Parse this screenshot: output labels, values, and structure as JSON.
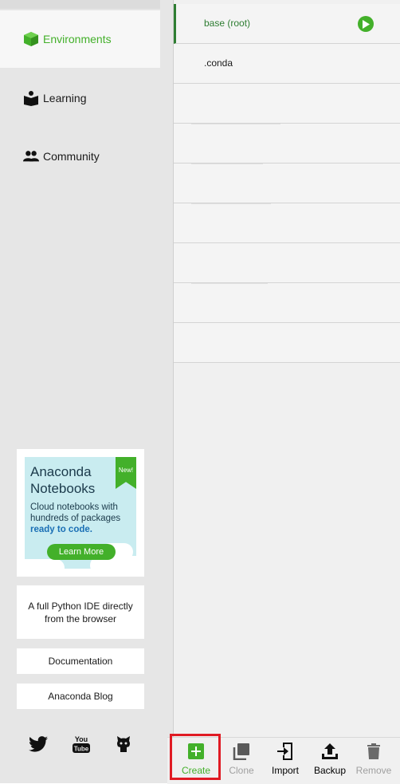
{
  "sidebar": {
    "nav": [
      {
        "label": "Environments",
        "icon": "cube-icon",
        "active": true
      },
      {
        "label": "Learning",
        "icon": "book-reader-icon",
        "active": false
      },
      {
        "label": "Community",
        "icon": "people-icon",
        "active": false
      }
    ],
    "promo": {
      "title_line1": "Anaconda",
      "title_line2": "Notebooks",
      "desc_line1": "Cloud notebooks with",
      "desc_line2": "hundreds of packages",
      "desc_highlight": "ready to code.",
      "badge": "New!",
      "button": "Learn More"
    },
    "ide_text": "A full Python IDE directly from the browser",
    "documentation": "Documentation",
    "blog": "Anaconda Blog",
    "social": [
      "twitter-icon",
      "youtube-icon",
      "github-icon"
    ],
    "youtube_text_top": "You",
    "youtube_text_bottom": "Tube"
  },
  "environments": [
    {
      "name": "base (root)",
      "active": true
    },
    {
      "name": ".conda",
      "active": false
    },
    {
      "name": "",
      "active": false
    },
    {
      "name": "",
      "active": false
    },
    {
      "name": "",
      "active": false
    },
    {
      "name": "",
      "active": false
    },
    {
      "name": "",
      "active": false
    },
    {
      "name": "",
      "active": false
    },
    {
      "name": "",
      "active": false
    }
  ],
  "toolbar": {
    "create": "Create",
    "clone": "Clone",
    "import": "Import",
    "backup": "Backup",
    "remove": "Remove"
  },
  "colors": {
    "accent": "#43b02a",
    "active_env": "#2e7d32",
    "highlight": "#e01b24"
  }
}
